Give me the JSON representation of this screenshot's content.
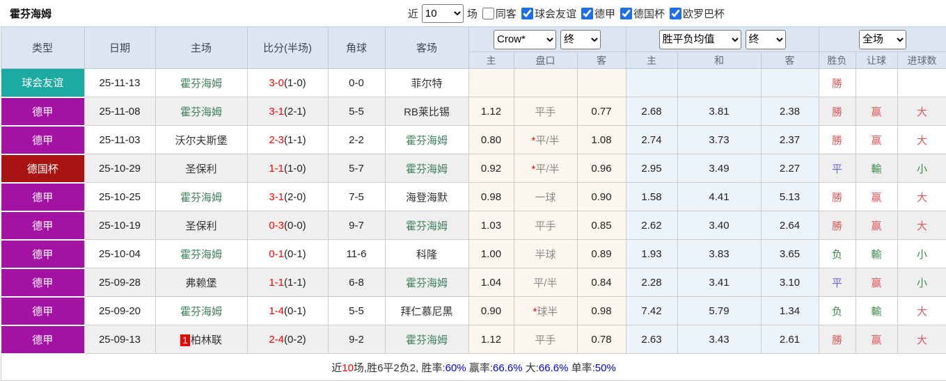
{
  "topbar": {
    "title": "霍芬海姆",
    "recent_label": "近",
    "recent_value": "10",
    "games_label": "场",
    "filters": [
      {
        "label": "同客",
        "checked": false
      },
      {
        "label": "球会友谊",
        "checked": true
      },
      {
        "label": "德甲",
        "checked": true
      },
      {
        "label": "德国杯",
        "checked": true
      },
      {
        "label": "欧罗巴杯",
        "checked": true
      }
    ]
  },
  "table": {
    "group_headers": [
      "类型",
      "日期",
      "主场",
      "比分(半场)",
      "角球",
      "客场"
    ],
    "selects": {
      "odds_company": "Crow*",
      "odds_time": "终",
      "avg_label": "胜平负均值",
      "avg_time": "终",
      "scope": "全场"
    },
    "sub_headers": [
      "主",
      "盘口",
      "客",
      "主",
      "和",
      "客",
      "胜负",
      "让球",
      "进球数"
    ],
    "type_colors": {
      "球会友谊": "#1CABA4",
      "德甲": "#A412A4",
      "德国杯": "#A71411"
    },
    "result_colors": {
      "win": "#DC5A5A",
      "draw": "#6667D2",
      "lose": "#3F8A4A"
    },
    "rows": [
      {
        "type": "球会友谊",
        "date": "25-11-13",
        "home": {
          "name": "霍芬海姆",
          "green": true,
          "badge": null
        },
        "score": "3-0",
        "half": "(1-0)",
        "corner": "0-0",
        "away": {
          "name": "菲尔特",
          "green": false
        },
        "odds": [
          "",
          "",
          ""
        ],
        "pan_star": false,
        "avg": [
          "",
          "",
          ""
        ],
        "result": {
          "text": "勝",
          "c": "win"
        },
        "handicap": {
          "text": "",
          "c": null
        },
        "goals": {
          "text": "",
          "c": null
        }
      },
      {
        "type": "德甲",
        "date": "25-11-08",
        "home": {
          "name": "霍芬海姆",
          "green": true,
          "badge": null
        },
        "score": "3-1",
        "half": "(2-1)",
        "corner": "5-5",
        "away": {
          "name": "RB莱比锡",
          "green": false
        },
        "odds": [
          "1.12",
          "平手",
          "0.77"
        ],
        "pan_star": false,
        "avg": [
          "2.68",
          "3.81",
          "2.38"
        ],
        "result": {
          "text": "勝",
          "c": "win"
        },
        "handicap": {
          "text": "赢",
          "c": "win"
        },
        "goals": {
          "text": "大",
          "c": "win"
        }
      },
      {
        "type": "德甲",
        "date": "25-11-03",
        "home": {
          "name": "沃尔夫斯堡",
          "green": false,
          "badge": null
        },
        "score": "2-3",
        "half": "(1-1)",
        "corner": "2-2",
        "away": {
          "name": "霍芬海姆",
          "green": true
        },
        "odds": [
          "0.80",
          "平/半",
          "1.08"
        ],
        "pan_star": true,
        "avg": [
          "2.74",
          "3.73",
          "2.37"
        ],
        "result": {
          "text": "勝",
          "c": "win"
        },
        "handicap": {
          "text": "赢",
          "c": "win"
        },
        "goals": {
          "text": "大",
          "c": "win"
        }
      },
      {
        "type": "德国杯",
        "date": "25-10-29",
        "home": {
          "name": "圣保利",
          "green": false,
          "badge": null
        },
        "score": "1-1",
        "half": "(1-0)",
        "corner": "5-7",
        "away": {
          "name": "霍芬海姆",
          "green": true
        },
        "odds": [
          "0.92",
          "平/半",
          "0.96"
        ],
        "pan_star": true,
        "avg": [
          "2.95",
          "3.49",
          "2.27"
        ],
        "result": {
          "text": "平",
          "c": "draw"
        },
        "handicap": {
          "text": "輸",
          "c": "lose"
        },
        "goals": {
          "text": "小",
          "c": "lose"
        }
      },
      {
        "type": "德甲",
        "date": "25-10-25",
        "home": {
          "name": "霍芬海姆",
          "green": true,
          "badge": null
        },
        "score": "3-1",
        "half": "(2-0)",
        "corner": "7-5",
        "away": {
          "name": "海登海默",
          "green": false
        },
        "odds": [
          "0.98",
          "一球",
          "0.90"
        ],
        "pan_star": false,
        "avg": [
          "1.58",
          "4.41",
          "5.13"
        ],
        "result": {
          "text": "勝",
          "c": "win"
        },
        "handicap": {
          "text": "赢",
          "c": "win"
        },
        "goals": {
          "text": "大",
          "c": "win"
        }
      },
      {
        "type": "德甲",
        "date": "25-10-19",
        "home": {
          "name": "圣保利",
          "green": false,
          "badge": null
        },
        "score": "0-3",
        "half": "(0-0)",
        "corner": "9-7",
        "away": {
          "name": "霍芬海姆",
          "green": true
        },
        "odds": [
          "1.03",
          "平手",
          "0.85"
        ],
        "pan_star": false,
        "avg": [
          "2.62",
          "3.40",
          "2.64"
        ],
        "result": {
          "text": "勝",
          "c": "win"
        },
        "handicap": {
          "text": "赢",
          "c": "win"
        },
        "goals": {
          "text": "大",
          "c": "win"
        }
      },
      {
        "type": "德甲",
        "date": "25-10-04",
        "home": {
          "name": "霍芬海姆",
          "green": true,
          "badge": null
        },
        "score": "0-1",
        "half": "(0-1)",
        "corner": "11-6",
        "away": {
          "name": "科隆",
          "green": false
        },
        "odds": [
          "1.00",
          "半球",
          "0.89"
        ],
        "pan_star": false,
        "avg": [
          "1.93",
          "3.83",
          "3.65"
        ],
        "result": {
          "text": "负",
          "c": "lose"
        },
        "handicap": {
          "text": "輸",
          "c": "lose"
        },
        "goals": {
          "text": "小",
          "c": "lose"
        }
      },
      {
        "type": "德甲",
        "date": "25-09-28",
        "home": {
          "name": "弗赖堡",
          "green": false,
          "badge": null
        },
        "score": "1-1",
        "half": "(1-1)",
        "corner": "6-8",
        "away": {
          "name": "霍芬海姆",
          "green": true
        },
        "odds": [
          "1.04",
          "平/半",
          "0.84"
        ],
        "pan_star": false,
        "avg": [
          "2.28",
          "3.41",
          "3.10"
        ],
        "result": {
          "text": "平",
          "c": "draw"
        },
        "handicap": {
          "text": "赢",
          "c": "win"
        },
        "goals": {
          "text": "小",
          "c": "lose"
        }
      },
      {
        "type": "德甲",
        "date": "25-09-20",
        "home": {
          "name": "霍芬海姆",
          "green": true,
          "badge": null
        },
        "score": "1-4",
        "half": "(0-1)",
        "corner": "5-5",
        "away": {
          "name": "拜仁慕尼黑",
          "green": false
        },
        "odds": [
          "0.90",
          "球半",
          "0.98"
        ],
        "pan_star": true,
        "avg": [
          "7.42",
          "5.79",
          "1.34"
        ],
        "result": {
          "text": "负",
          "c": "lose"
        },
        "handicap": {
          "text": "輸",
          "c": "lose"
        },
        "goals": {
          "text": "大",
          "c": "win"
        }
      },
      {
        "type": "德甲",
        "date": "25-09-13",
        "home": {
          "name": "柏林联",
          "green": false,
          "badge": "1"
        },
        "score": "2-4",
        "half": "(0-2)",
        "corner": "9-2",
        "away": {
          "name": "霍芬海姆",
          "green": true
        },
        "odds": [
          "1.12",
          "平手",
          "0.78"
        ],
        "pan_star": false,
        "avg": [
          "2.63",
          "3.43",
          "2.61"
        ],
        "result": {
          "text": "勝",
          "c": "win"
        },
        "handicap": {
          "text": "赢",
          "c": "win"
        },
        "goals": {
          "text": "大",
          "c": "win"
        }
      }
    ]
  },
  "summary": {
    "parts": [
      {
        "text": "近",
        "color": "#333333"
      },
      {
        "text": "10",
        "color": "#FF0000"
      },
      {
        "text": "场,胜6平2负2, 胜率:",
        "color": "#333333"
      },
      {
        "text": "60%",
        "color": "#0000E6"
      },
      {
        "text": " 赢率:",
        "color": "#333333"
      },
      {
        "text": "66.6%",
        "color": "#0000E6"
      },
      {
        "text": " 大:",
        "color": "#333333"
      },
      {
        "text": "66.6%",
        "color": "#0000E6"
      },
      {
        "text": " 单率:",
        "color": "#333333"
      },
      {
        "text": "50%",
        "color": "#0000E6"
      }
    ]
  }
}
